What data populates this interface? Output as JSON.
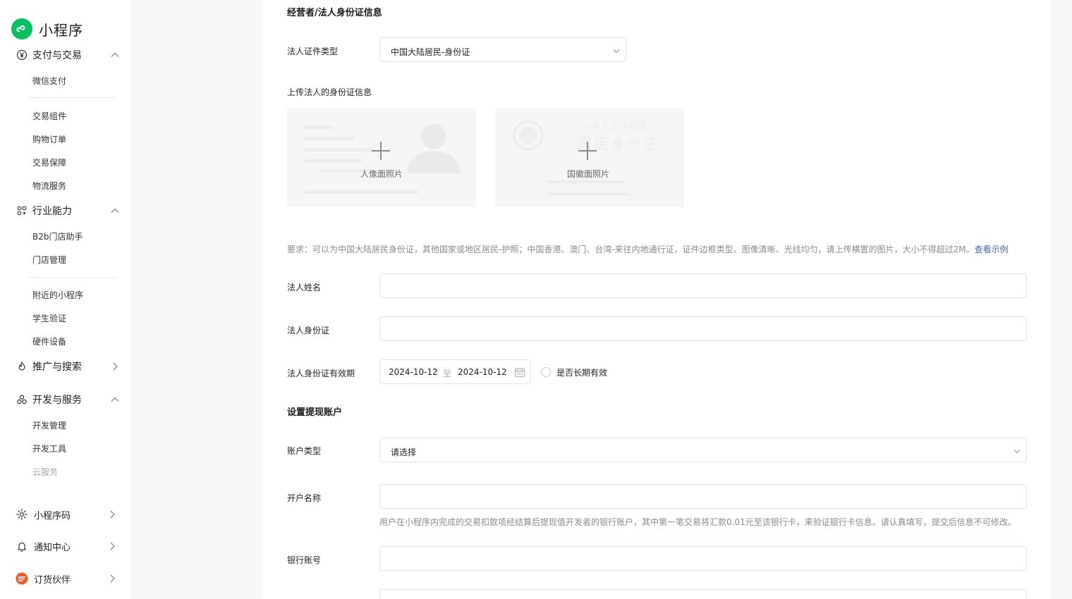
{
  "brand": {
    "title": "小程序",
    "logo_color": "#07c160"
  },
  "sidebar": {
    "sections": [
      {
        "label": "支付与交易",
        "icon": "yen-circle-icon",
        "expanded": true,
        "items": [
          "微信支付",
          "交易组件",
          "购物订单",
          "交易保障",
          "物流服务"
        ]
      },
      {
        "label": "行业能力",
        "icon": "industry-icon",
        "expanded": true,
        "items": [
          "B2b门店助手",
          "门店管理",
          "附近的小程序",
          "学生验证",
          "硬件设备"
        ]
      },
      {
        "label": "推广与搜索",
        "icon": "flame-icon",
        "expanded": false,
        "items": []
      },
      {
        "label": "开发与服务",
        "icon": "dev-service-icon",
        "expanded": true,
        "items": [
          "开发管理",
          "开发工具",
          "云服务"
        ]
      },
      {
        "label": "小程序码",
        "icon": "qrcode-sun-icon",
        "expanded": false,
        "items": []
      },
      {
        "label": "通知中心",
        "icon": "bell-icon",
        "expanded": false,
        "items": []
      },
      {
        "label": "订货伙伴",
        "icon": "order-partner-icon",
        "expanded": false,
        "items": []
      }
    ]
  },
  "form": {
    "section_title": "经营者/法人身份证信息",
    "id_type_label": "法人证件类型",
    "id_type_value": "中国大陆居民-身份证",
    "upload_label": "上传法人的身份证信息",
    "upload_front": "人像面照片",
    "upload_back": "国徽面照片",
    "id_back_print_line1": "中华人民共和国",
    "id_back_print_line2": "居民身份证",
    "requirement_text": "要求：可以为中国大陆居民身份证，其他国家或地区居民-护照；中国香港、澳门、台湾-来往内地通行证，证件边框类型、图像清晰、光线均匀，请上传横置的图片，大小不得超过2M。",
    "requirement_link": "查看示例",
    "name_label": "法人姓名",
    "id_number_label": "法人身份证",
    "validity_label": "法人身份证有效期",
    "date_start": "2024-10-12",
    "date_sep": "至",
    "date_end": "2024-10-12",
    "long_term_label": "是否长期有效",
    "long_term_checked": false,
    "withdraw_title": "设置提现账户",
    "account_type_label": "账户类型",
    "account_type_placeholder": "请选择",
    "account_name_label": "开户名称",
    "account_hint": "用户在小程序内完成的交易扣款项经结算后提现值开发者的银行账户，其中第一笔交易将汇款0.01元至该银行卡，来验证银行卡信息。请认真填写，提交后信息不可修改。",
    "bank_account_label": "银行账号",
    "link_color": "#3f69b0"
  }
}
